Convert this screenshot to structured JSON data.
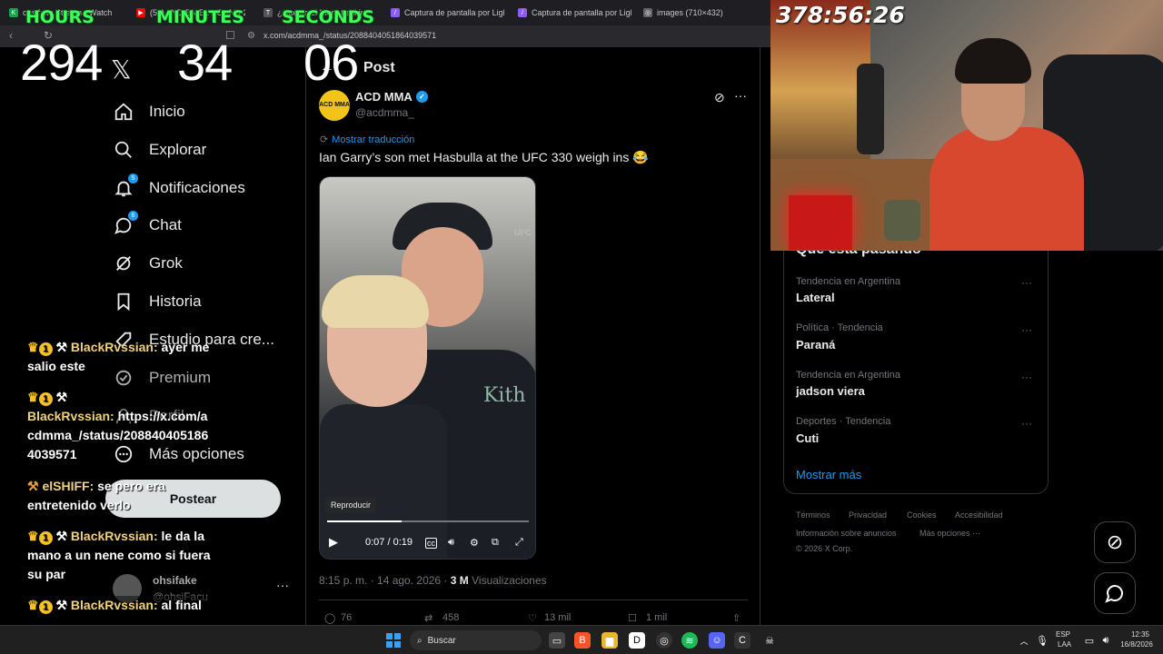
{
  "browser": {
    "tabs": [
      {
        "label": "ohsifake Stream - Watch",
        "color": "#16a34a"
      },
      {
        "label": "(59) TYD EN EL ROUND 2",
        "color": "#ff0000"
      },
      {
        "label": "¿Qué es el \"hero tracking\"?",
        "color": "#555555"
      },
      {
        "label": "Captura de pantalla por Light",
        "color": "#8b5cf6"
      },
      {
        "label": "Captura de pantalla por Light",
        "color": "#8b5cf6"
      },
      {
        "label": "images (710×432)",
        "color": "#666666"
      }
    ],
    "url": "x.com/acdmma_/status/2088404051864039571"
  },
  "countdown": {
    "labels": {
      "hours": "HOURS",
      "minutes": "MINUTES",
      "seconds": "SECONDS"
    },
    "hours": "294",
    "minutes": "34",
    "seconds": "06"
  },
  "sidebar": {
    "logo": "𝕏",
    "items": [
      {
        "label": "Inicio",
        "icon": "home-icon"
      },
      {
        "label": "Explorar",
        "icon": "search-icon"
      },
      {
        "label": "Notificaciones",
        "icon": "bell-icon",
        "badge": "5"
      },
      {
        "label": "Chat",
        "icon": "chat-icon",
        "badge": "6"
      },
      {
        "label": "Grok",
        "icon": "grok-icon"
      },
      {
        "label": "Historia",
        "icon": "bookmark-icon"
      },
      {
        "label": "Estudio para cre...",
        "icon": "rocket-icon"
      },
      {
        "label": "Premium",
        "icon": "premium-icon"
      },
      {
        "label": "Perfil",
        "icon": "person-icon"
      },
      {
        "label": "Más opciones",
        "icon": "more-icon"
      }
    ],
    "post_button": "Postear",
    "account": {
      "name": "ohsifake",
      "handle": "@ohsiFacu"
    }
  },
  "post": {
    "header_title": "Post",
    "author": {
      "name": "ACD MMA",
      "handle": "@acdmma_",
      "avatar_text": "ACD MMA"
    },
    "translate_label": "Mostrar traducción",
    "text": "Ian Garry’s son met Hasbulla at the UFC 330 weigh ins 😂",
    "video": {
      "replay_label": "Reproducir",
      "time": "0:07 / 0:19",
      "progress": 0.37,
      "shirt_text": "Kith",
      "bg_text": "UFC"
    },
    "timestamp": "8:15 p. m. · 14 ago. 2026 ·",
    "views_count": "3 M",
    "views_label": "Visualizaciones",
    "actions": {
      "replies": "76",
      "reposts": "458",
      "likes": "13 mil",
      "bookmarks": "1 mil"
    }
  },
  "trends": {
    "title": "Qué está pasando",
    "items": [
      {
        "context": "Tendencia en Argentina",
        "name": "Lateral"
      },
      {
        "context": "Política · Tendencia",
        "name": "Paraná"
      },
      {
        "context": "Tendencia en Argentina",
        "name": "jadson viera"
      },
      {
        "context": "Deportes · Tendencia",
        "name": "Cuti"
      }
    ],
    "show_more": "Mostrar más"
  },
  "footer": {
    "links": [
      "Términos",
      "Privacidad",
      "Cookies",
      "Accesibilidad",
      "Información sobre anuncios",
      "Más opciones ···"
    ],
    "copyright": "© 2026 X Corp."
  },
  "stream": {
    "timer": "378:56:26"
  },
  "chat": [
    {
      "user": "BlackRvssian:",
      "text": "ayer me salio este"
    },
    {
      "user": "BlackRvssian:",
      "text": "https://x.com/acdmma_/status/2088404051864039571"
    },
    {
      "user": "elSHIFF:",
      "text": "se pero era entretenido verlo"
    },
    {
      "user": "BlackRvssian:",
      "text": "le da la mano a un nene como si fuera su par"
    },
    {
      "user": "BlackRvssian:",
      "text": "al final"
    }
  ],
  "taskbar": {
    "search": "Buscar",
    "lang_top": "ESP",
    "lang_bottom": "LAA",
    "time": "12:35",
    "date": "16/8/2026"
  }
}
